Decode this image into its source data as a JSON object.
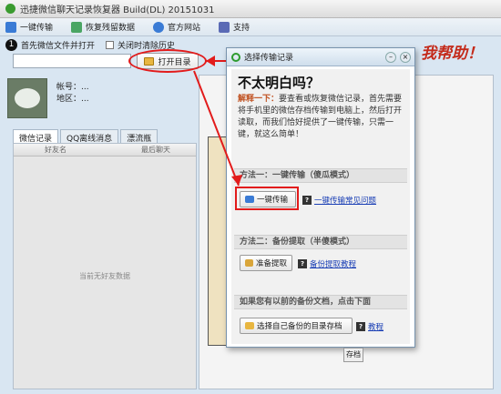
{
  "app": {
    "title": "迅捷微信聊天记录恢复器 Build(DL) 20151031",
    "toolbar": {
      "items": [
        {
          "label": "一键传输",
          "icon": "transfer-icon",
          "color": "#3a7bd5"
        },
        {
          "label": "恢复残留数据",
          "icon": "restore-icon",
          "color": "#4aa564"
        },
        {
          "label": "官方网站",
          "icon": "globe-icon",
          "color": "#3a7bd5"
        },
        {
          "label": "支持",
          "icon": "support-icon",
          "color": "#5a6ab5"
        }
      ]
    },
    "options": {
      "step": "1",
      "open_on_start": "首先微信文件并打开",
      "clear_history": "关闭时清除历史"
    },
    "open_button": "打开目录",
    "account": {
      "account_label": "帐号：...",
      "region_label": "地区：..."
    },
    "tabs": [
      "微信记录",
      "QQ离线消息",
      "漂流瓶"
    ],
    "list": {
      "col_friend": "好友名",
      "col_last": "最后聊天",
      "empty": "当前无好友数据"
    },
    "help_text": "我帮助！"
  },
  "dialog": {
    "title": "选择传输记录",
    "question": "不太明白吗？",
    "explain_lead": "解释一下：",
    "explain_body": "要查看或恢复微信记录，首先需要将手机里的微信存档传输到电脑上，然后打开读取，而我们恰好提供了一键传输，只需一键，就这么简单！",
    "method1": {
      "title": "方法一：一键传输（傻瓜模式）",
      "button": "一键传输",
      "link": "一键传输常见问题"
    },
    "method2": {
      "title": "方法二：备份提取（半傻模式）",
      "button": "准备提取",
      "link": "备份提取教程"
    },
    "method3": {
      "title": "如果您有以前的备份文档，点击下面",
      "button": "选择自己备份的目录存档",
      "link": "教程"
    },
    "fragment": "存档"
  },
  "colors": {
    "accent_red": "#e21b1b",
    "link_blue": "#1a3fb5"
  }
}
